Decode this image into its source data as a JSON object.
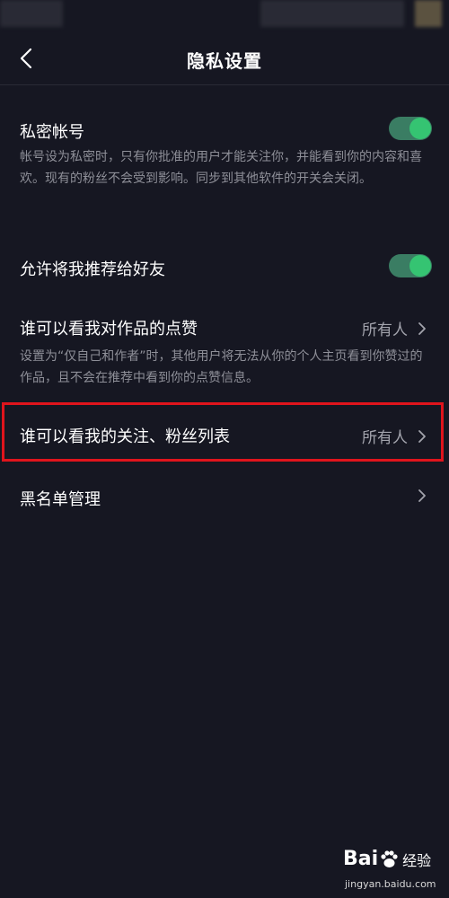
{
  "header": {
    "title": "隐私设置"
  },
  "settings": {
    "private_account": {
      "title": "私密帐号",
      "description": "帐号设为私密时，只有你批准的用户才能关注你，并能看到你的内容和喜欢。现有的粉丝不会受到影响。同步到其他软件的开关会关闭。",
      "enabled": true
    },
    "recommend_to_friends": {
      "title": "允许将我推荐给好友",
      "enabled": true
    },
    "likes_visibility": {
      "title": "谁可以看我对作品的点赞",
      "value": "所有人",
      "description": "设置为“仅自己和作者”时，其他用户将无法从你的个人主页看到你赞过的作品，且不会在推荐中看到你的点赞信息。"
    },
    "follow_list_visibility": {
      "title": "谁可以看我的关注、粉丝列表",
      "value": "所有人"
    },
    "blacklist": {
      "title": "黑名单管理"
    }
  },
  "watermark": {
    "brand_left": "Bai",
    "brand_right": "经验",
    "url": "jingyan.baidu.com"
  },
  "colors": {
    "background": "#161722",
    "toggle_on": "#35c472",
    "highlight": "#e0141c",
    "secondary_text": "#8e8f98"
  }
}
